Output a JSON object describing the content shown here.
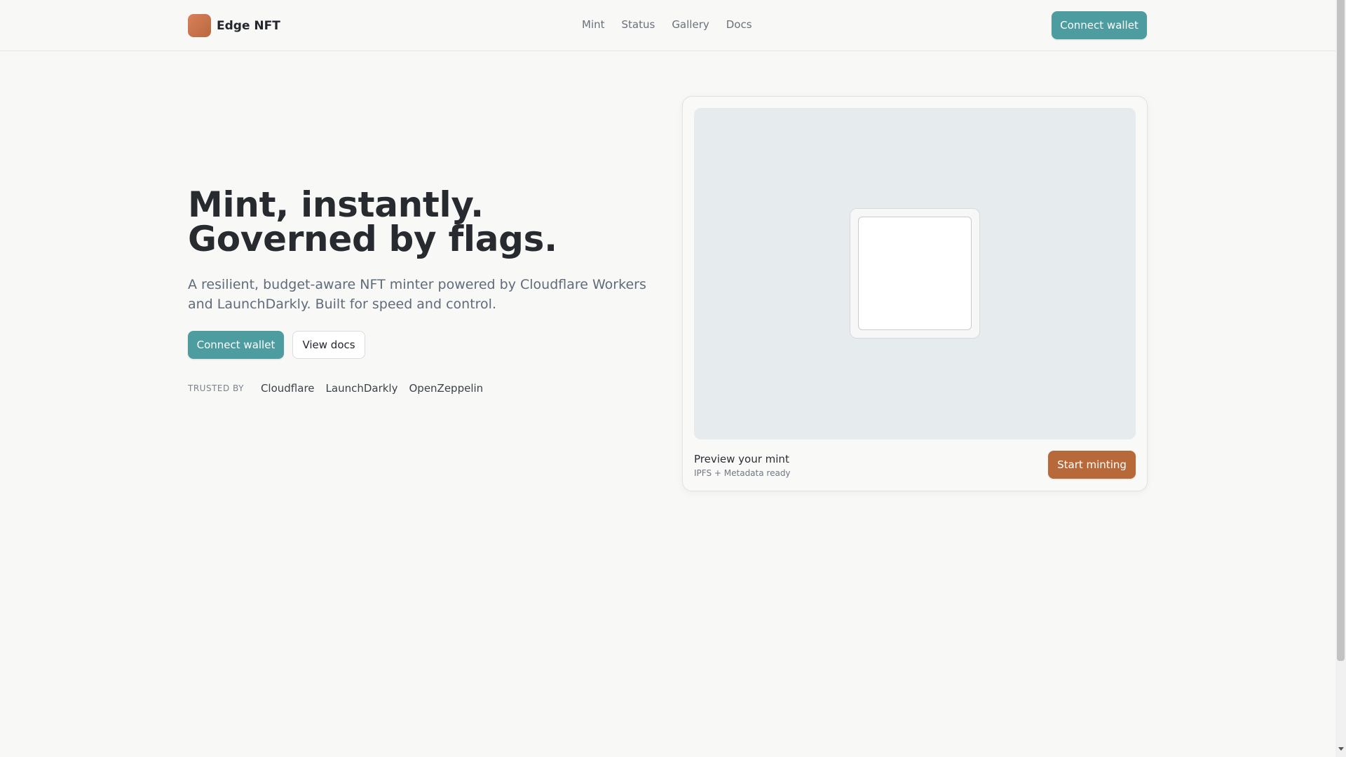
{
  "brand": {
    "name": "Edge NFT",
    "logo_icon": "edge-nft-logo-icon"
  },
  "nav": {
    "items": [
      "Mint",
      "Status",
      "Gallery",
      "Docs"
    ]
  },
  "header": {
    "connect_label": "Connect wallet"
  },
  "hero": {
    "title": "Mint, instantly. Governed by flags.",
    "subtitle": "A resilient, budget-aware NFT minter powered by Cloudflare Workers and LaunchDarkly. Built for speed and control.",
    "primary_label": "Connect wallet",
    "secondary_label": "View docs",
    "trusted_label": "TRUSTED BY",
    "trusted": [
      "Cloudflare",
      "LaunchDarkly",
      "OpenZeppelin"
    ]
  },
  "card": {
    "title": "Preview your mint",
    "subtitle": "IPFS + Metadata ready",
    "action_label": "Start minting"
  },
  "colors": {
    "primary": "#4c9ca0",
    "accent": "#b7693a",
    "background": "#f8f8f7",
    "preview_bg": "#e6ebee"
  }
}
